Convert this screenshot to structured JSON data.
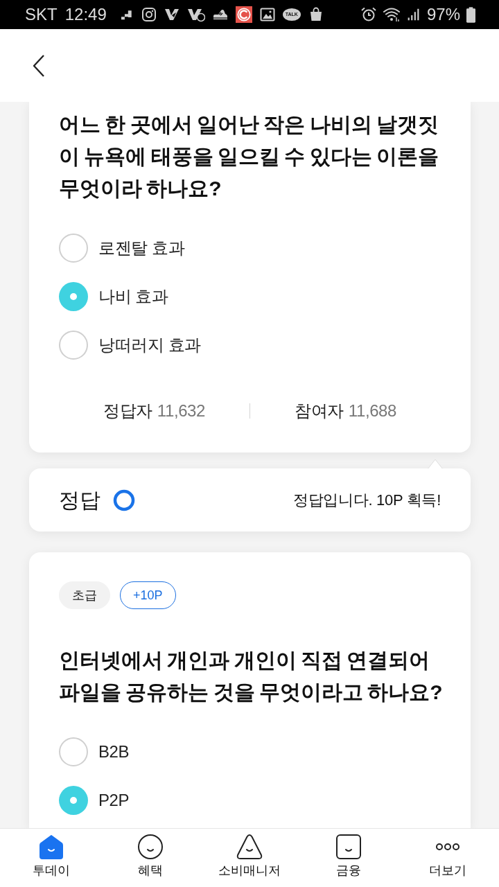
{
  "status_bar": {
    "carrier": "SKT",
    "time": "12:49",
    "chat_badge": "TALK",
    "battery": "97%"
  },
  "quizzes": [
    {
      "question": "어느 한 곳에서 일어난 작은 나비의 날갯짓이 뉴욕에 태풍을 일으킬 수 있다는 이론을 무엇이라 하나요?",
      "options": [
        {
          "label": "로젠탈 효과",
          "selected": false
        },
        {
          "label": "나비 효과",
          "selected": true
        },
        {
          "label": "낭떠러지 효과",
          "selected": false
        }
      ],
      "stats": [
        {
          "label": "정답자",
          "value": "11,632"
        },
        {
          "label": "참여자",
          "value": "11,688"
        }
      ],
      "result": {
        "label": "정답",
        "correct": true,
        "message": "정답입니다. 10P 획득!"
      }
    },
    {
      "tags": [
        {
          "kind": "level",
          "label": "초급"
        },
        {
          "kind": "points",
          "label": "+10P"
        }
      ],
      "question": "인터넷에서 개인과 개인이 직접 연결되어 파일을 공유하는 것을 무엇이라고 하나요?",
      "options": [
        {
          "label": "B2B",
          "selected": false
        },
        {
          "label": "P2P",
          "selected": true
        }
      ]
    }
  ],
  "bottom_nav": [
    {
      "label": "투데이",
      "selected": true
    },
    {
      "label": "혜택",
      "selected": false
    },
    {
      "label": "소비매니저",
      "selected": false
    },
    {
      "label": "금융",
      "selected": false
    },
    {
      "label": "더보기",
      "selected": false
    }
  ]
}
